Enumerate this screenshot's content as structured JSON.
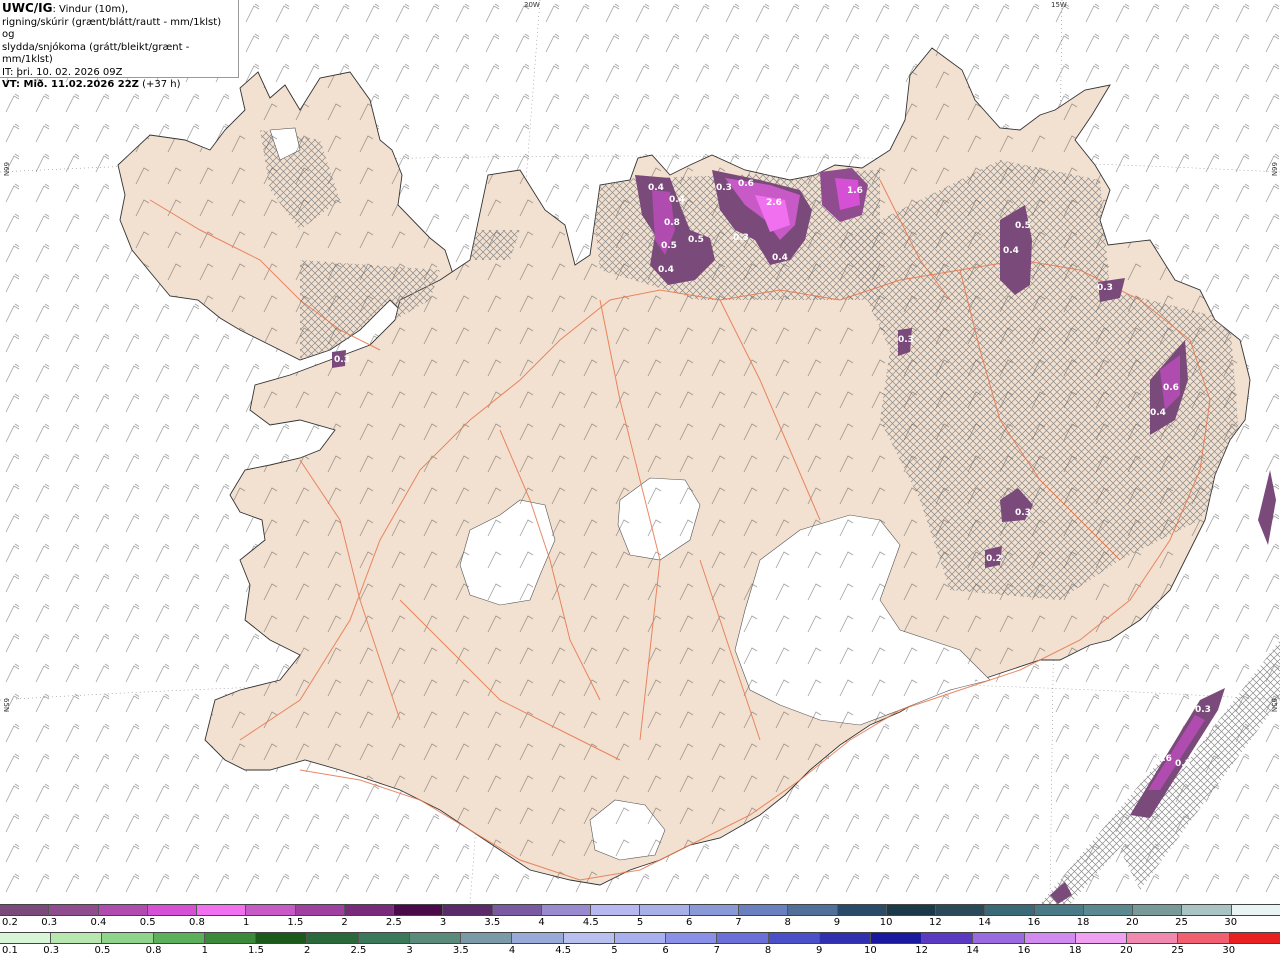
{
  "info": {
    "brand": "UWC/IG",
    "line1_rest": ": Vindur (10m),",
    "line2": "rigning/skúrir (grænt/blátt/rautt - mm/1klst) og",
    "line3": "slydda/snjókoma (grátt/bleikt/grænt - mm/1klst)",
    "it": "IT: þri. 10. 02. 2026 09Z",
    "vt_bold": "VT: Mið. 11.02.2026 22Z",
    "vt_rest": " (+37 h)"
  },
  "graticule": {
    "lon_top": [
      "20W",
      "15W"
    ],
    "lat_left": [
      "66N",
      "65N"
    ],
    "lat_right": [
      "66N",
      "65N"
    ]
  },
  "precip_values": [
    "0.4",
    "0.4",
    "0.8",
    "0.5",
    "0.5",
    "0.4",
    "0.6",
    "0.3",
    "2.6",
    "0.3",
    "0.4",
    "1.6",
    "0.5",
    "0.4",
    "0.3",
    "0.3",
    "0.6",
    "0.4",
    "0.3",
    "0.2",
    "0.3",
    "0.6",
    "0.3",
    "0.3"
  ],
  "colors": {
    "sea": "#ffffff",
    "land": "#f2e0d0",
    "glacier": "#ffffff",
    "roads": "#e8744a",
    "hatch": "#888888"
  },
  "legend": {
    "snow": {
      "ticks": [
        "0.2",
        "0.3",
        "0.4",
        "0.5",
        "0.8",
        "1",
        "1.5",
        "2",
        "2.5",
        "3",
        "3.5",
        "4",
        "4.5",
        "5",
        "6",
        "7",
        "8",
        "9",
        "10",
        "12",
        "14",
        "16",
        "18",
        "20",
        "25",
        "30"
      ],
      "colors": [
        "#7a4a7a",
        "#8f4c8f",
        "#b04cb0",
        "#d650d6",
        "#f070f0",
        "#c85ac8",
        "#a040a0",
        "#7a2a7a",
        "#4a0a4a",
        "#5a2a6a",
        "#7a5aa0",
        "#9a8ad0",
        "#b8b8f0",
        "#a8b0e8",
        "#8a9ad8",
        "#6a80c0",
        "#50709a",
        "#2a4a6a",
        "#1a3a4a",
        "#2a4a5a",
        "#3a6a78",
        "#4a7a88",
        "#5a8a90",
        "#7a9a9a",
        "#aac4c4",
        "#e8f4f4"
      ]
    },
    "rain": {
      "ticks": [
        "0.1",
        "0.3",
        "0.5",
        "0.8",
        "1",
        "1.5",
        "2",
        "2.5",
        "3",
        "3.5",
        "4",
        "4.5",
        "5",
        "6",
        "7",
        "8",
        "9",
        "10",
        "12",
        "14",
        "16",
        "18",
        "20",
        "25",
        "30"
      ],
      "colors": [
        "#d8f5d8",
        "#b8e8b0",
        "#8ed48a",
        "#5cb05c",
        "#3a8a3a",
        "#1a5a1a",
        "#2a6a3a",
        "#3a7a5a",
        "#5a8a7a",
        "#7a9aa8",
        "#9aaad8",
        "#b8c0f0",
        "#a8b0f0",
        "#8a90e8",
        "#6a70d8",
        "#4a50c8",
        "#3030b0",
        "#1a1aa0",
        "#5a3ac0",
        "#9a6ae0",
        "#d08af0",
        "#f0a0f0",
        "#f088b0",
        "#f06070",
        "#e82020"
      ]
    }
  }
}
